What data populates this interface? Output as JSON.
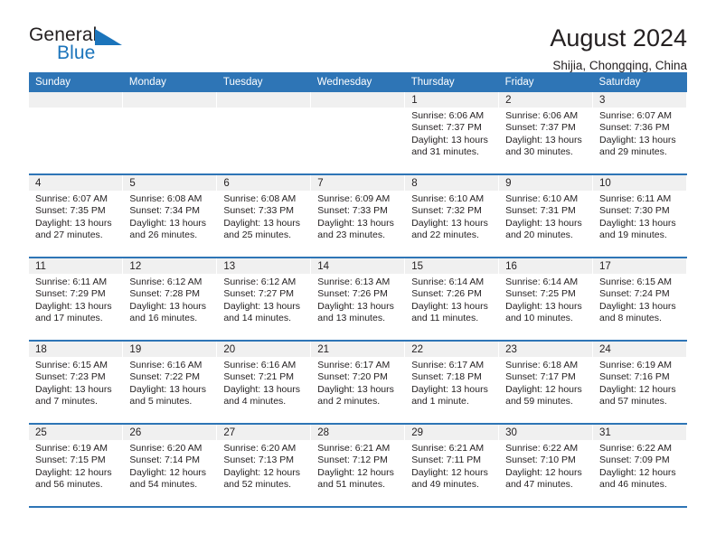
{
  "brand": {
    "word_one": "General",
    "word_two": "Blue",
    "triangle_color": "#1b74bb"
  },
  "header": {
    "title": "August 2024",
    "subtitle": "Shijia, Chongqing, China"
  },
  "theme": {
    "header_blue": "#2e75b6",
    "daynum_bg": "#f0f0f0",
    "text": "#231f20"
  },
  "calendar": {
    "weekday_headers": [
      "Sunday",
      "Monday",
      "Tuesday",
      "Wednesday",
      "Thursday",
      "Friday",
      "Saturday"
    ],
    "labels": {
      "sunrise": "Sunrise:",
      "sunset": "Sunset:",
      "daylight": "Daylight:"
    },
    "weeks": [
      [
        {
          "day": "",
          "empty": true
        },
        {
          "day": "",
          "empty": true
        },
        {
          "day": "",
          "empty": true
        },
        {
          "day": "",
          "empty": true
        },
        {
          "day": "1",
          "sunrise": "Sunrise: 6:06 AM",
          "sunset": "Sunset: 7:37 PM",
          "daylight": "Daylight: 13 hours and 31 minutes."
        },
        {
          "day": "2",
          "sunrise": "Sunrise: 6:06 AM",
          "sunset": "Sunset: 7:37 PM",
          "daylight": "Daylight: 13 hours and 30 minutes."
        },
        {
          "day": "3",
          "sunrise": "Sunrise: 6:07 AM",
          "sunset": "Sunset: 7:36 PM",
          "daylight": "Daylight: 13 hours and 29 minutes."
        }
      ],
      [
        {
          "day": "4",
          "sunrise": "Sunrise: 6:07 AM",
          "sunset": "Sunset: 7:35 PM",
          "daylight": "Daylight: 13 hours and 27 minutes."
        },
        {
          "day": "5",
          "sunrise": "Sunrise: 6:08 AM",
          "sunset": "Sunset: 7:34 PM",
          "daylight": "Daylight: 13 hours and 26 minutes."
        },
        {
          "day": "6",
          "sunrise": "Sunrise: 6:08 AM",
          "sunset": "Sunset: 7:33 PM",
          "daylight": "Daylight: 13 hours and 25 minutes."
        },
        {
          "day": "7",
          "sunrise": "Sunrise: 6:09 AM",
          "sunset": "Sunset: 7:33 PM",
          "daylight": "Daylight: 13 hours and 23 minutes."
        },
        {
          "day": "8",
          "sunrise": "Sunrise: 6:10 AM",
          "sunset": "Sunset: 7:32 PM",
          "daylight": "Daylight: 13 hours and 22 minutes."
        },
        {
          "day": "9",
          "sunrise": "Sunrise: 6:10 AM",
          "sunset": "Sunset: 7:31 PM",
          "daylight": "Daylight: 13 hours and 20 minutes."
        },
        {
          "day": "10",
          "sunrise": "Sunrise: 6:11 AM",
          "sunset": "Sunset: 7:30 PM",
          "daylight": "Daylight: 13 hours and 19 minutes."
        }
      ],
      [
        {
          "day": "11",
          "sunrise": "Sunrise: 6:11 AM",
          "sunset": "Sunset: 7:29 PM",
          "daylight": "Daylight: 13 hours and 17 minutes."
        },
        {
          "day": "12",
          "sunrise": "Sunrise: 6:12 AM",
          "sunset": "Sunset: 7:28 PM",
          "daylight": "Daylight: 13 hours and 16 minutes."
        },
        {
          "day": "13",
          "sunrise": "Sunrise: 6:12 AM",
          "sunset": "Sunset: 7:27 PM",
          "daylight": "Daylight: 13 hours and 14 minutes."
        },
        {
          "day": "14",
          "sunrise": "Sunrise: 6:13 AM",
          "sunset": "Sunset: 7:26 PM",
          "daylight": "Daylight: 13 hours and 13 minutes."
        },
        {
          "day": "15",
          "sunrise": "Sunrise: 6:14 AM",
          "sunset": "Sunset: 7:26 PM",
          "daylight": "Daylight: 13 hours and 11 minutes."
        },
        {
          "day": "16",
          "sunrise": "Sunrise: 6:14 AM",
          "sunset": "Sunset: 7:25 PM",
          "daylight": "Daylight: 13 hours and 10 minutes."
        },
        {
          "day": "17",
          "sunrise": "Sunrise: 6:15 AM",
          "sunset": "Sunset: 7:24 PM",
          "daylight": "Daylight: 13 hours and 8 minutes."
        }
      ],
      [
        {
          "day": "18",
          "sunrise": "Sunrise: 6:15 AM",
          "sunset": "Sunset: 7:23 PM",
          "daylight": "Daylight: 13 hours and 7 minutes."
        },
        {
          "day": "19",
          "sunrise": "Sunrise: 6:16 AM",
          "sunset": "Sunset: 7:22 PM",
          "daylight": "Daylight: 13 hours and 5 minutes."
        },
        {
          "day": "20",
          "sunrise": "Sunrise: 6:16 AM",
          "sunset": "Sunset: 7:21 PM",
          "daylight": "Daylight: 13 hours and 4 minutes."
        },
        {
          "day": "21",
          "sunrise": "Sunrise: 6:17 AM",
          "sunset": "Sunset: 7:20 PM",
          "daylight": "Daylight: 13 hours and 2 minutes."
        },
        {
          "day": "22",
          "sunrise": "Sunrise: 6:17 AM",
          "sunset": "Sunset: 7:18 PM",
          "daylight": "Daylight: 13 hours and 1 minute."
        },
        {
          "day": "23",
          "sunrise": "Sunrise: 6:18 AM",
          "sunset": "Sunset: 7:17 PM",
          "daylight": "Daylight: 12 hours and 59 minutes."
        },
        {
          "day": "24",
          "sunrise": "Sunrise: 6:19 AM",
          "sunset": "Sunset: 7:16 PM",
          "daylight": "Daylight: 12 hours and 57 minutes."
        }
      ],
      [
        {
          "day": "25",
          "sunrise": "Sunrise: 6:19 AM",
          "sunset": "Sunset: 7:15 PM",
          "daylight": "Daylight: 12 hours and 56 minutes."
        },
        {
          "day": "26",
          "sunrise": "Sunrise: 6:20 AM",
          "sunset": "Sunset: 7:14 PM",
          "daylight": "Daylight: 12 hours and 54 minutes."
        },
        {
          "day": "27",
          "sunrise": "Sunrise: 6:20 AM",
          "sunset": "Sunset: 7:13 PM",
          "daylight": "Daylight: 12 hours and 52 minutes."
        },
        {
          "day": "28",
          "sunrise": "Sunrise: 6:21 AM",
          "sunset": "Sunset: 7:12 PM",
          "daylight": "Daylight: 12 hours and 51 minutes."
        },
        {
          "day": "29",
          "sunrise": "Sunrise: 6:21 AM",
          "sunset": "Sunset: 7:11 PM",
          "daylight": "Daylight: 12 hours and 49 minutes."
        },
        {
          "day": "30",
          "sunrise": "Sunrise: 6:22 AM",
          "sunset": "Sunset: 7:10 PM",
          "daylight": "Daylight: 12 hours and 47 minutes."
        },
        {
          "day": "31",
          "sunrise": "Sunrise: 6:22 AM",
          "sunset": "Sunset: 7:09 PM",
          "daylight": "Daylight: 12 hours and 46 minutes."
        }
      ]
    ]
  }
}
